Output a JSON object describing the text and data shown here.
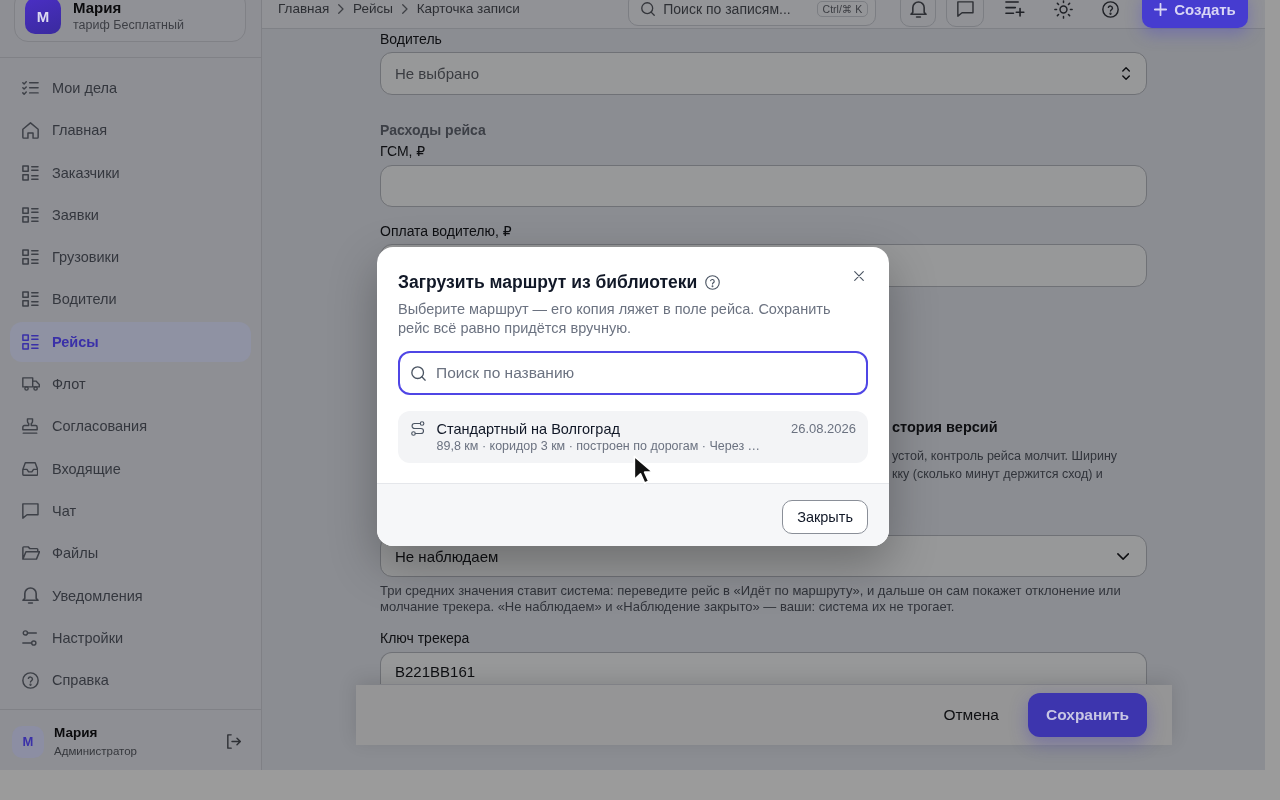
{
  "sidebar": {
    "account": {
      "initial": "М",
      "name": "Мария",
      "plan": "тариф Бесплатный"
    },
    "nav": [
      {
        "label": "Мои дела",
        "selected": false
      },
      {
        "label": "Главная",
        "selected": false
      },
      {
        "label": "Заказчики",
        "selected": false
      },
      {
        "label": "Заявки",
        "selected": false
      },
      {
        "label": "Грузовики",
        "selected": false
      },
      {
        "label": "Водители",
        "selected": false
      },
      {
        "label": "Рейсы",
        "selected": true
      },
      {
        "label": "Флот",
        "selected": false
      },
      {
        "label": "Согласования",
        "selected": false
      },
      {
        "label": "Входящие",
        "selected": false
      },
      {
        "label": "Чат",
        "selected": false
      },
      {
        "label": "Файлы",
        "selected": false
      },
      {
        "label": "Уведомления",
        "selected": false
      },
      {
        "label": "Настройки",
        "selected": false
      },
      {
        "label": "Справка",
        "selected": false
      }
    ],
    "user": {
      "initial": "М",
      "name": "Мария",
      "role": "Администратор"
    }
  },
  "topbar": {
    "breadcrumbs": [
      "Главная",
      "Рейсы",
      "Карточка записи"
    ],
    "search": {
      "placeholder": "Поиск по записям...",
      "shortcut": "Ctrl/⌘ K"
    },
    "create_button": "Создать"
  },
  "form": {
    "driver": {
      "label": "Водитель",
      "placeholder": "Не выбрано"
    },
    "expenses": {
      "title": "Расходы рейса",
      "fields": [
        {
          "label": "ГСМ, ₽"
        },
        {
          "label": "Оплата водителю, ₽"
        }
      ]
    },
    "version_history": "стория версий",
    "corridor_hint": [
      "устой, контроль рейса молчит. Ширину",
      "кку (сколько минут держится сход) и"
    ],
    "monitoring": {
      "value": "Не наблюдаем",
      "hint": "Три средних значения ставит система: переведите рейс в «Идёт по маршруту», и дальше он сам покажет отклонение или молчание трекера. «Не наблюдаем» и «Наблюдение закрыто» — ваши: система их не трогает."
    },
    "tracker_key": {
      "label": "Ключ трекера",
      "value": "B221BB161"
    }
  },
  "actions": {
    "cancel": "Отмена",
    "save": "Сохранить"
  },
  "dialog": {
    "title": "Загрузить маршрут из библиотеки",
    "description": "Выберите маршрут — его копия ляжет в поле рейса. Сохранить рейс всё равно придётся вручную.",
    "search": {
      "placeholder": "Поиск по названию"
    },
    "routes": [
      {
        "name": "Стандартный на Волгоград",
        "meta": "89,8 км · коридор 3 км · построен по дорогам · Через …",
        "date": "26.08.2026"
      }
    ],
    "close_button": "Закрыть"
  }
}
